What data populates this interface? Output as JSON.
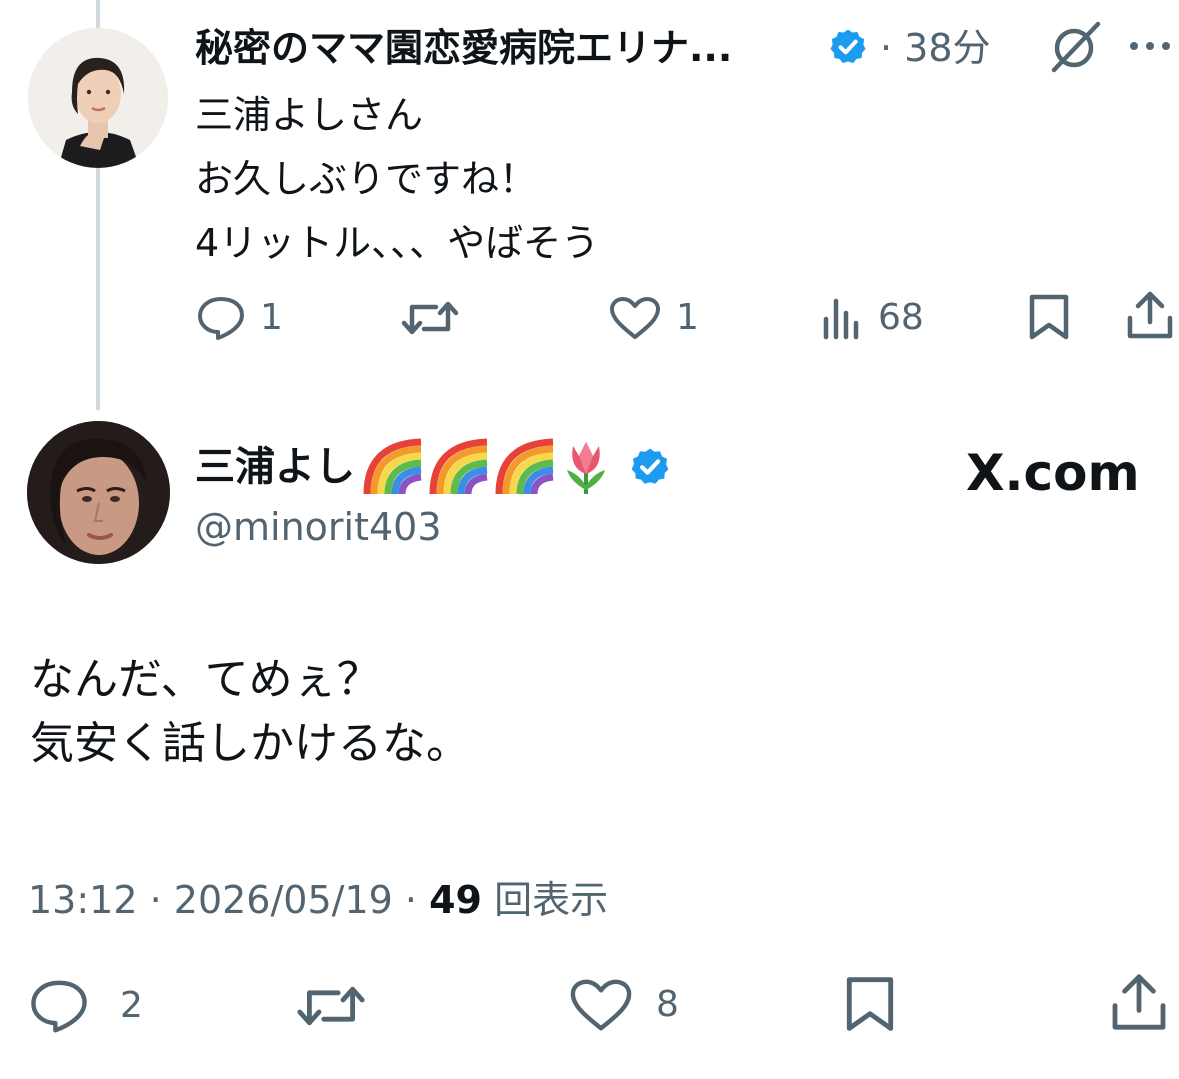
{
  "reply_tweet": {
    "author_name": "秘密のママ園恋愛病院エリナ...",
    "time": "38分",
    "text_lines": [
      "三浦よしさん",
      "お久しぶりですね！",
      "4リットル、、、やばそう"
    ],
    "replies": "1",
    "likes": "1",
    "views": "68",
    "verified_color": "#1d9bf0"
  },
  "main_tweet": {
    "author_name": "三浦よし",
    "name_emojis": [
      "rainbow",
      "rainbow",
      "rainbow",
      "tulip"
    ],
    "handle": "@minorit403",
    "watermark": "X.com",
    "text_lines": [
      "なんだ、てめぇ？",
      "気安く話しかけるな。"
    ],
    "time": "13:12",
    "date": "2026/05/19",
    "views_count": "49",
    "views_label": "回表示",
    "replies": "2",
    "likes": "8"
  },
  "colors": {
    "text_primary": "#0f1419",
    "text_secondary": "#536471",
    "thread_line": "#cfd9de",
    "verified": "#1d9bf0"
  },
  "icons": [
    "comment-icon",
    "retweet-icon",
    "heart-icon",
    "views-icon",
    "bookmark-icon",
    "share-icon",
    "grok-icon",
    "more-icon",
    "verified-icon",
    "rainbow-emoji",
    "tulip-emoji"
  ]
}
